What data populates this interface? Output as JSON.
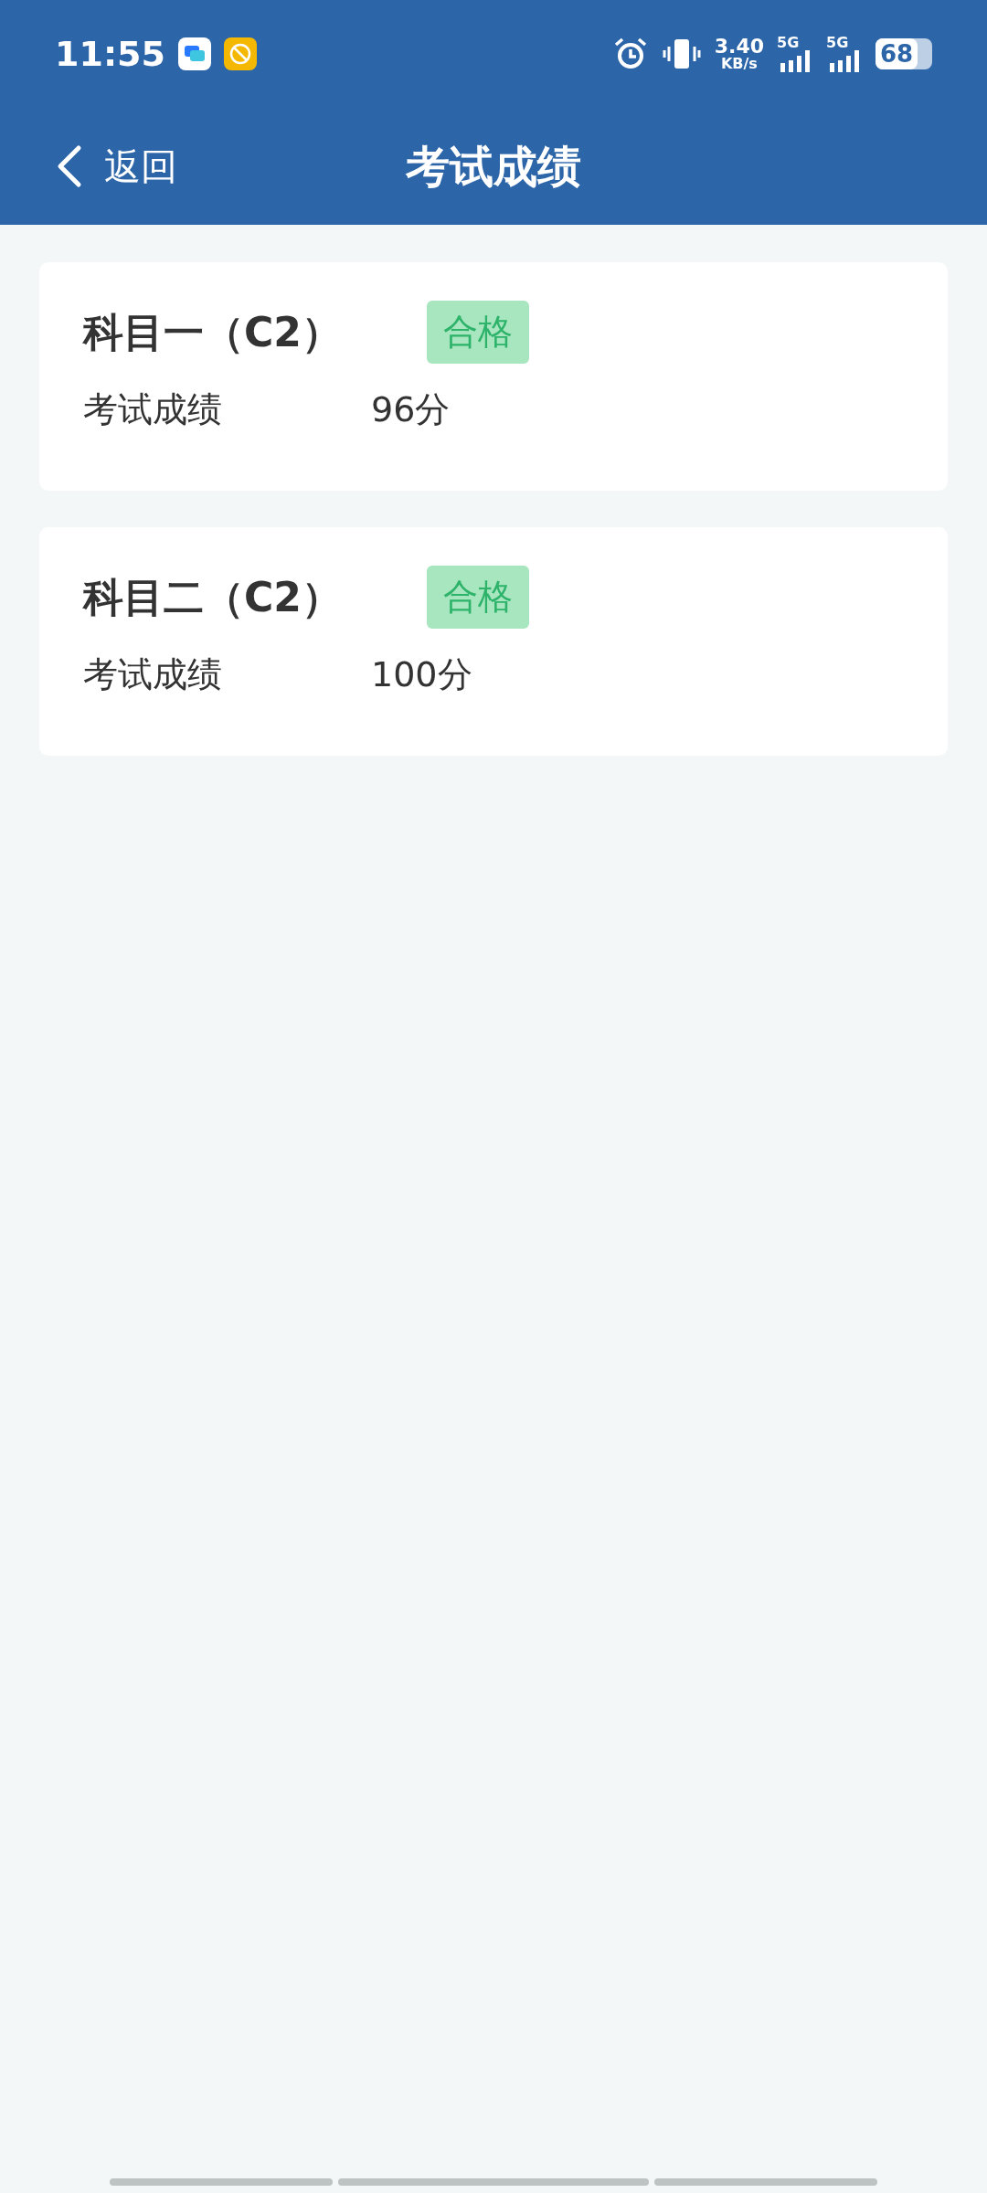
{
  "status_bar": {
    "time": "11:55",
    "net_speed": "3.40",
    "net_unit": "KB/s",
    "network_1": "5G",
    "network_2": "5G",
    "battery": "68"
  },
  "header": {
    "back_label": "返回",
    "title": "考试成绩"
  },
  "results": [
    {
      "subject": "科目一（C2）",
      "status": "合格",
      "kind": "pass",
      "label": "考试成绩",
      "score": "96分"
    },
    {
      "subject": "科目二（C2）",
      "status": "合格",
      "kind": "pass",
      "label": "考试成绩",
      "score": "100分"
    }
  ]
}
